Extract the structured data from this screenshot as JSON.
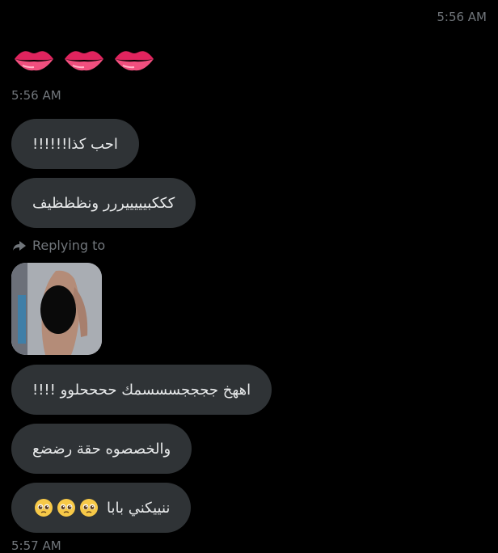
{
  "timestamps": {
    "top": "5:56 AM",
    "mid": "5:56 AM",
    "bottom": "5:57 AM"
  },
  "icons": {
    "lips": [
      "kiss-lips-icon",
      "kiss-lips-icon",
      "kiss-lips-icon"
    ],
    "reply": "reply-arrow-icon",
    "pleading": [
      "pleading-face-icon",
      "pleading-face-icon",
      "pleading-face-icon"
    ]
  },
  "reply_label": "Replying to",
  "messages": [
    {
      "text": "احب كذا!!!!!!"
    },
    {
      "text": "كككبيييييررر ونظظظيف"
    },
    {
      "text": "اههخ ججججسسسمك ححححلوو !!!!"
    },
    {
      "text": "والخصصوه حقة رضضع"
    },
    {
      "text": "ننييكني بابا"
    }
  ],
  "colors": {
    "background": "#000000",
    "bubble": "#2f3336",
    "muted_text": "#71767b",
    "text": "#e7e9ea"
  }
}
